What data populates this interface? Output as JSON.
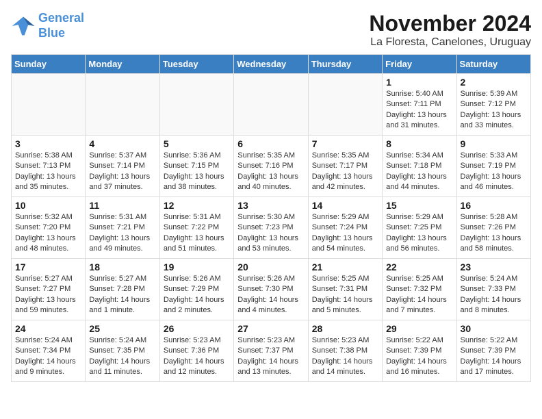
{
  "logo": {
    "line1": "General",
    "line2": "Blue"
  },
  "title": "November 2024",
  "location": "La Floresta, Canelones, Uruguay",
  "days_of_week": [
    "Sunday",
    "Monday",
    "Tuesday",
    "Wednesday",
    "Thursday",
    "Friday",
    "Saturday"
  ],
  "weeks": [
    [
      {
        "day": "",
        "info": ""
      },
      {
        "day": "",
        "info": ""
      },
      {
        "day": "",
        "info": ""
      },
      {
        "day": "",
        "info": ""
      },
      {
        "day": "",
        "info": ""
      },
      {
        "day": "1",
        "info": "Sunrise: 5:40 AM\nSunset: 7:11 PM\nDaylight: 13 hours and 31 minutes."
      },
      {
        "day": "2",
        "info": "Sunrise: 5:39 AM\nSunset: 7:12 PM\nDaylight: 13 hours and 33 minutes."
      }
    ],
    [
      {
        "day": "3",
        "info": "Sunrise: 5:38 AM\nSunset: 7:13 PM\nDaylight: 13 hours and 35 minutes."
      },
      {
        "day": "4",
        "info": "Sunrise: 5:37 AM\nSunset: 7:14 PM\nDaylight: 13 hours and 37 minutes."
      },
      {
        "day": "5",
        "info": "Sunrise: 5:36 AM\nSunset: 7:15 PM\nDaylight: 13 hours and 38 minutes."
      },
      {
        "day": "6",
        "info": "Sunrise: 5:35 AM\nSunset: 7:16 PM\nDaylight: 13 hours and 40 minutes."
      },
      {
        "day": "7",
        "info": "Sunrise: 5:35 AM\nSunset: 7:17 PM\nDaylight: 13 hours and 42 minutes."
      },
      {
        "day": "8",
        "info": "Sunrise: 5:34 AM\nSunset: 7:18 PM\nDaylight: 13 hours and 44 minutes."
      },
      {
        "day": "9",
        "info": "Sunrise: 5:33 AM\nSunset: 7:19 PM\nDaylight: 13 hours and 46 minutes."
      }
    ],
    [
      {
        "day": "10",
        "info": "Sunrise: 5:32 AM\nSunset: 7:20 PM\nDaylight: 13 hours and 48 minutes."
      },
      {
        "day": "11",
        "info": "Sunrise: 5:31 AM\nSunset: 7:21 PM\nDaylight: 13 hours and 49 minutes."
      },
      {
        "day": "12",
        "info": "Sunrise: 5:31 AM\nSunset: 7:22 PM\nDaylight: 13 hours and 51 minutes."
      },
      {
        "day": "13",
        "info": "Sunrise: 5:30 AM\nSunset: 7:23 PM\nDaylight: 13 hours and 53 minutes."
      },
      {
        "day": "14",
        "info": "Sunrise: 5:29 AM\nSunset: 7:24 PM\nDaylight: 13 hours and 54 minutes."
      },
      {
        "day": "15",
        "info": "Sunrise: 5:29 AM\nSunset: 7:25 PM\nDaylight: 13 hours and 56 minutes."
      },
      {
        "day": "16",
        "info": "Sunrise: 5:28 AM\nSunset: 7:26 PM\nDaylight: 13 hours and 58 minutes."
      }
    ],
    [
      {
        "day": "17",
        "info": "Sunrise: 5:27 AM\nSunset: 7:27 PM\nDaylight: 13 hours and 59 minutes."
      },
      {
        "day": "18",
        "info": "Sunrise: 5:27 AM\nSunset: 7:28 PM\nDaylight: 14 hours and 1 minute."
      },
      {
        "day": "19",
        "info": "Sunrise: 5:26 AM\nSunset: 7:29 PM\nDaylight: 14 hours and 2 minutes."
      },
      {
        "day": "20",
        "info": "Sunrise: 5:26 AM\nSunset: 7:30 PM\nDaylight: 14 hours and 4 minutes."
      },
      {
        "day": "21",
        "info": "Sunrise: 5:25 AM\nSunset: 7:31 PM\nDaylight: 14 hours and 5 minutes."
      },
      {
        "day": "22",
        "info": "Sunrise: 5:25 AM\nSunset: 7:32 PM\nDaylight: 14 hours and 7 minutes."
      },
      {
        "day": "23",
        "info": "Sunrise: 5:24 AM\nSunset: 7:33 PM\nDaylight: 14 hours and 8 minutes."
      }
    ],
    [
      {
        "day": "24",
        "info": "Sunrise: 5:24 AM\nSunset: 7:34 PM\nDaylight: 14 hours and 9 minutes."
      },
      {
        "day": "25",
        "info": "Sunrise: 5:24 AM\nSunset: 7:35 PM\nDaylight: 14 hours and 11 minutes."
      },
      {
        "day": "26",
        "info": "Sunrise: 5:23 AM\nSunset: 7:36 PM\nDaylight: 14 hours and 12 minutes."
      },
      {
        "day": "27",
        "info": "Sunrise: 5:23 AM\nSunset: 7:37 PM\nDaylight: 14 hours and 13 minutes."
      },
      {
        "day": "28",
        "info": "Sunrise: 5:23 AM\nSunset: 7:38 PM\nDaylight: 14 hours and 14 minutes."
      },
      {
        "day": "29",
        "info": "Sunrise: 5:22 AM\nSunset: 7:39 PM\nDaylight: 14 hours and 16 minutes."
      },
      {
        "day": "30",
        "info": "Sunrise: 5:22 AM\nSunset: 7:39 PM\nDaylight: 14 hours and 17 minutes."
      }
    ]
  ]
}
